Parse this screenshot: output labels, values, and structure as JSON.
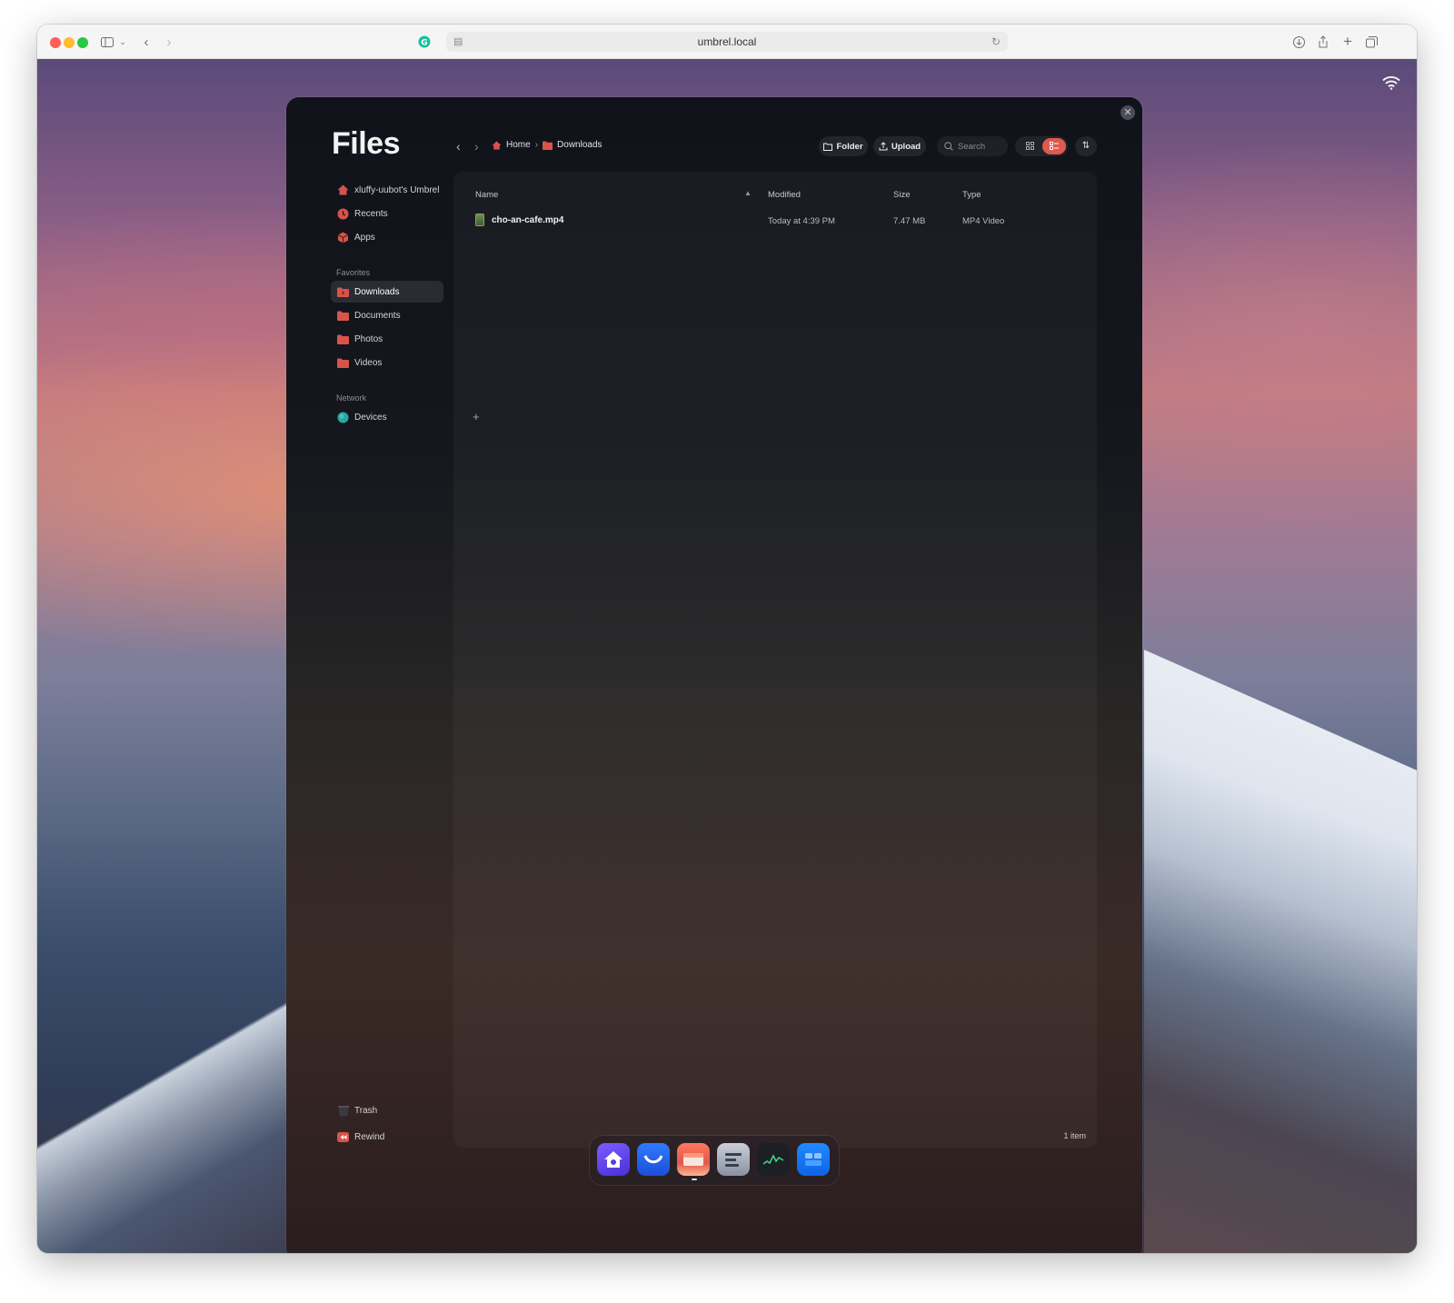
{
  "browser": {
    "url": "umbrel.local"
  },
  "files": {
    "title": "Files",
    "sidebar": {
      "top_items": [
        {
          "label": "xluffy-uubot's Umbrel",
          "icon": "home-icon"
        },
        {
          "label": "Recents",
          "icon": "clock-icon"
        },
        {
          "label": "Apps",
          "icon": "cube-icon"
        }
      ],
      "favorites_heading": "Favorites",
      "favorites": [
        {
          "label": "Downloads",
          "icon": "folder-icon",
          "active": true
        },
        {
          "label": "Documents",
          "icon": "folder-icon"
        },
        {
          "label": "Photos",
          "icon": "folder-icon"
        },
        {
          "label": "Videos",
          "icon": "folder-icon"
        }
      ],
      "network_heading": "Network",
      "network_item": {
        "label": "Devices",
        "icon": "globe-icon"
      },
      "bottom_items": [
        {
          "label": "Trash",
          "icon": "trash-icon"
        },
        {
          "label": "Rewind",
          "icon": "rewind-icon"
        }
      ]
    },
    "breadcrumb": {
      "home": "Home",
      "current": "Downloads"
    },
    "toolbar": {
      "folder_label": "Folder",
      "upload_label": "Upload",
      "search_placeholder": "Search"
    },
    "table": {
      "headers": {
        "name": "Name",
        "modified": "Modified",
        "size": "Size",
        "type": "Type"
      },
      "rows": [
        {
          "name": "cho-an-cafe.mp4",
          "modified": "Today at 4:39 PM",
          "size": "7.47 MB",
          "type": "MP4 Video"
        }
      ]
    },
    "footer": {
      "item_count": "1 item"
    }
  },
  "dock": {
    "apps": [
      "umbrel-home-icon",
      "app-store-icon",
      "files-app-icon",
      "settings-icon",
      "live-usage-icon",
      "widgets-icon"
    ]
  },
  "colors": {
    "accent": "#e0584e",
    "folder": "#d9534a",
    "panel_bg": "#14171d"
  }
}
